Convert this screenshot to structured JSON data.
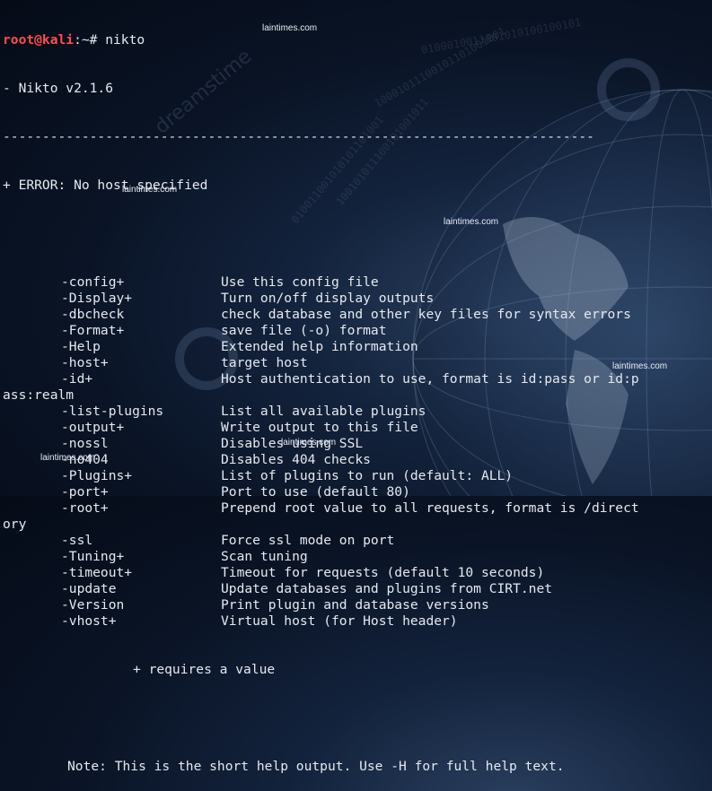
{
  "prompt": {
    "user_host": "root@kali",
    "path_sep": ":~#",
    "command": "nikto"
  },
  "version_line": "- Nikto v2.1.6",
  "separator": "---------------------------------------------------------------------------",
  "error_line": "+ ERROR: No host specified",
  "options": [
    {
      "flag": "-config+",
      "desc": "Use this config file"
    },
    {
      "flag": "-Display+",
      "desc": "Turn on/off display outputs"
    },
    {
      "flag": "-dbcheck",
      "desc": "check database and other key files for syntax errors"
    },
    {
      "flag": "-Format+",
      "desc": "save file (-o) format"
    },
    {
      "flag": "-Help",
      "desc": "Extended help information"
    },
    {
      "flag": "-host+",
      "desc": "target host"
    },
    {
      "flag": "-id+",
      "desc": "Host authentication to use, format is id:pass or id:p",
      "wrap": "ass:realm"
    },
    {
      "flag": "-list-plugins",
      "desc": "List all available plugins"
    },
    {
      "flag": "-output+",
      "desc": "Write output to this file"
    },
    {
      "flag": "-nossl",
      "desc": "Disables using SSL"
    },
    {
      "flag": "-no404",
      "desc": "Disables 404 checks"
    },
    {
      "flag": "-Plugins+",
      "desc": "List of plugins to run (default: ALL)"
    },
    {
      "flag": "-port+",
      "desc": "Port to use (default 80)"
    },
    {
      "flag": "-root+",
      "desc": "Prepend root value to all requests, format is /direct",
      "wrap": "ory"
    },
    {
      "flag": "-ssl",
      "desc": "Force ssl mode on port"
    },
    {
      "flag": "-Tuning+",
      "desc": "Scan tuning"
    },
    {
      "flag": "-timeout+",
      "desc": "Timeout for requests (default 10 seconds)"
    },
    {
      "flag": "-update",
      "desc": "Update databases and plugins from CIRT.net"
    },
    {
      "flag": "-Version",
      "desc": "Print plugin and database versions"
    },
    {
      "flag": "-vhost+",
      "desc": "Virtual host (for Host header)"
    }
  ],
  "requires_note": "+ requires a value",
  "note": "Note: This is the short help output. Use -H for full help text.",
  "watermark": "laintimes.com",
  "colors": {
    "prompt_red": "#ff4b4b",
    "text": "#e6e9ef",
    "background": "#0a1426"
  }
}
